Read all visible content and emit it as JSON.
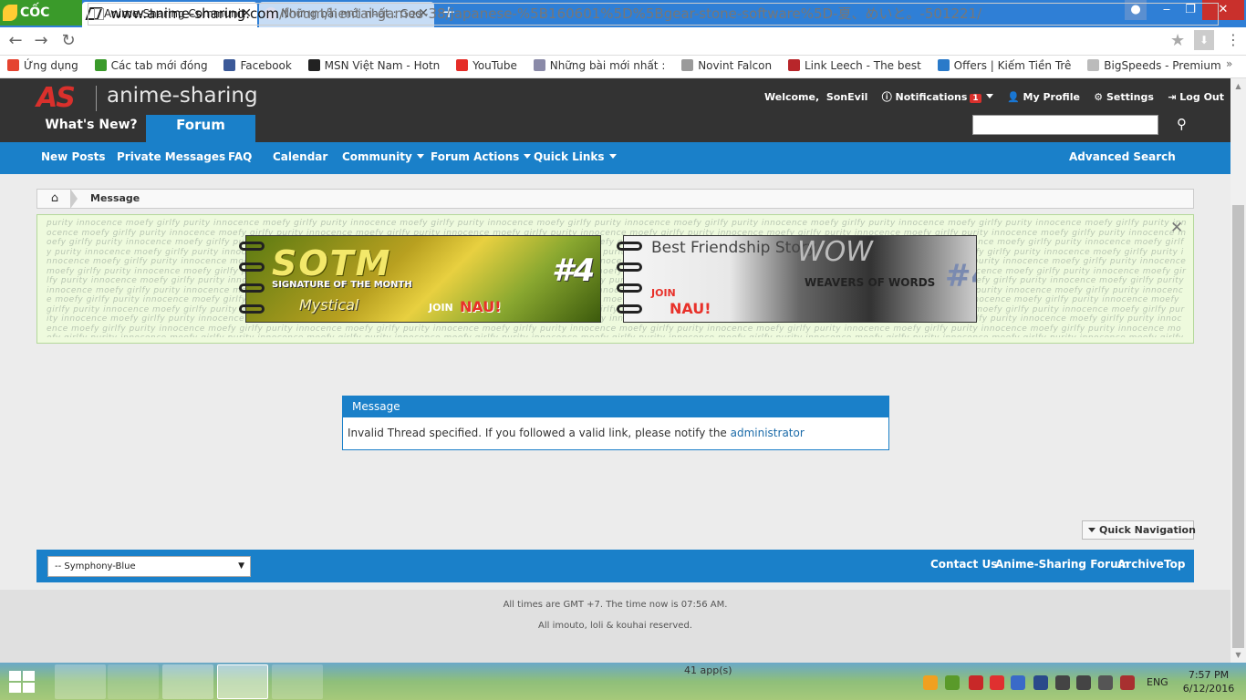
{
  "browser": {
    "brand": "CỐC CỐC",
    "tabs": [
      {
        "title": "Anime-Sharing Communit"
      },
      {
        "title": "Những bài mới nhất : Goo"
      }
    ],
    "url_domain": "www.anime-sharing.com",
    "url_path": "/forum/hentai-games-38/japanese-%5B160601%5D%5Bgear-stone-software%5D-夏、めいと。-501221/",
    "bookmarks": [
      {
        "label": "Ứng dụng",
        "color": "#e5432f"
      },
      {
        "label": "Các tab mới đóng",
        "color": "#3a9a2a"
      },
      {
        "label": "Facebook",
        "color": "#3b5998"
      },
      {
        "label": "MSN Việt Nam - Hotn",
        "color": "#222222"
      },
      {
        "label": "YouTube",
        "color": "#e52d27"
      },
      {
        "label": "Những bài mới nhất :",
        "color": "#8a8aa8"
      },
      {
        "label": "Novint Falcon",
        "color": "#9a9a9a"
      },
      {
        "label": "Link Leech - The best",
        "color": "#b8262a"
      },
      {
        "label": "Offers | Kiếm Tiền Trê",
        "color": "#2a7ac9"
      },
      {
        "label": "BigSpeeds - Premium",
        "color": "#bbbbbb"
      }
    ]
  },
  "site": {
    "logo_mark": "AS",
    "logo_text": "anime-sharing",
    "whats_new": "What's New?",
    "forum_tab": "Forum",
    "welcome": "Welcome,",
    "username": "SonEvil",
    "notifications": "Notifications",
    "notifications_count": "1",
    "my_profile": "My Profile",
    "settings": "Settings",
    "logout": "Log Out",
    "nav": {
      "new_posts": "New Posts",
      "private_messages": "Private Messages",
      "faq": "FAQ",
      "calendar": "Calendar",
      "community": "Community",
      "forum_actions": "Forum Actions",
      "quick_links": "Quick Links",
      "advanced_search": "Advanced Search"
    },
    "breadcrumb_current": "Message",
    "banner_pattern": "purity innocence moefy girlfy ",
    "banners": {
      "sotm_title": "SOTM",
      "sotm_sub": "SIGNATURE OF THE MONTH",
      "sotm_name": "Mystical",
      "sotm_num": "#4",
      "join": "JOIN",
      "nau": "NAU!",
      "bfs_title": "Best Friendship Story",
      "bfs_wow": "WOW",
      "bfs_sub": "WEAVERS OF WORDS",
      "bfs_num": "#4"
    },
    "message": {
      "title": "Message",
      "text": "Invalid Thread specified. If you followed a valid link, please notify the ",
      "link": "administrator"
    },
    "quick_navigation": "Quick Navigation",
    "style_selected": "-- Symphony-Blue",
    "footer_links": {
      "contact": "Contact Us",
      "forum": "Anime-Sharing Forum",
      "archive": "Archive",
      "top": "Top"
    },
    "footer_time": "All times are GMT +7. The time now is 07:56 AM.",
    "footer_reserved": "All imouto, loli & kouhai reserved."
  },
  "taskbar": {
    "apps_count": "41 app(s)",
    "lang": "ENG",
    "time": "7:57 PM",
    "date": "6/12/2016"
  },
  "colors": {
    "accent": "#1a80c9",
    "header": "#333333",
    "brand_red": "#d9302c"
  }
}
